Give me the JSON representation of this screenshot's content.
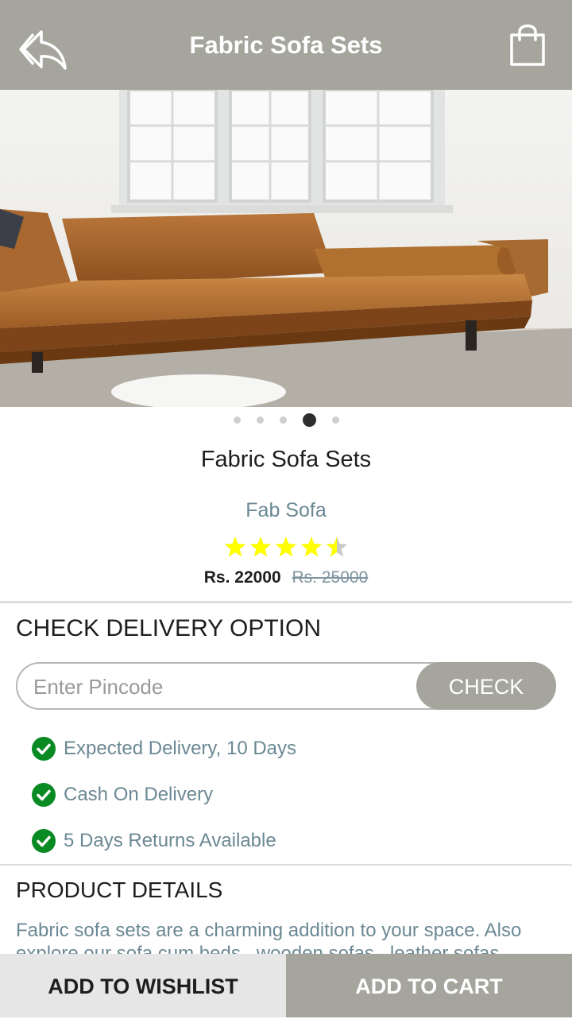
{
  "header": {
    "title": "Fabric Sofa Sets",
    "back_icon": "back-reply-icon",
    "cart_icon": "shopping-bag-icon"
  },
  "gallery": {
    "image": "leather-sofa-photo",
    "slide_count": 5,
    "active_slide": 4
  },
  "product": {
    "name": "Fabric Sofa Sets",
    "brand": "Fab Sofa",
    "rating": 4.5,
    "rating_max": 5,
    "price": "Rs. 22000",
    "original_price": "Rs. 25000"
  },
  "delivery": {
    "heading": "CHECK DELIVERY OPTION",
    "pincode_placeholder": "Enter Pincode",
    "check_label": "CHECK",
    "features": [
      "Expected Delivery, 10 Days",
      "Cash On Delivery",
      "5 Days Returns Available"
    ]
  },
  "details": {
    "heading": "PRODUCT DETAILS",
    "body": "Fabric sofa sets are a charming addition to your space. Also explore our sofa cum beds , wooden sofas , leather sofas"
  },
  "actions": {
    "wishlist_label": "ADD TO WISHLIST",
    "cart_label": "ADD TO CART"
  },
  "colors": {
    "bar": "#a6a59d",
    "accent_text": "#6b8894",
    "star": "#ffff00",
    "tick": "#0a8a22"
  }
}
